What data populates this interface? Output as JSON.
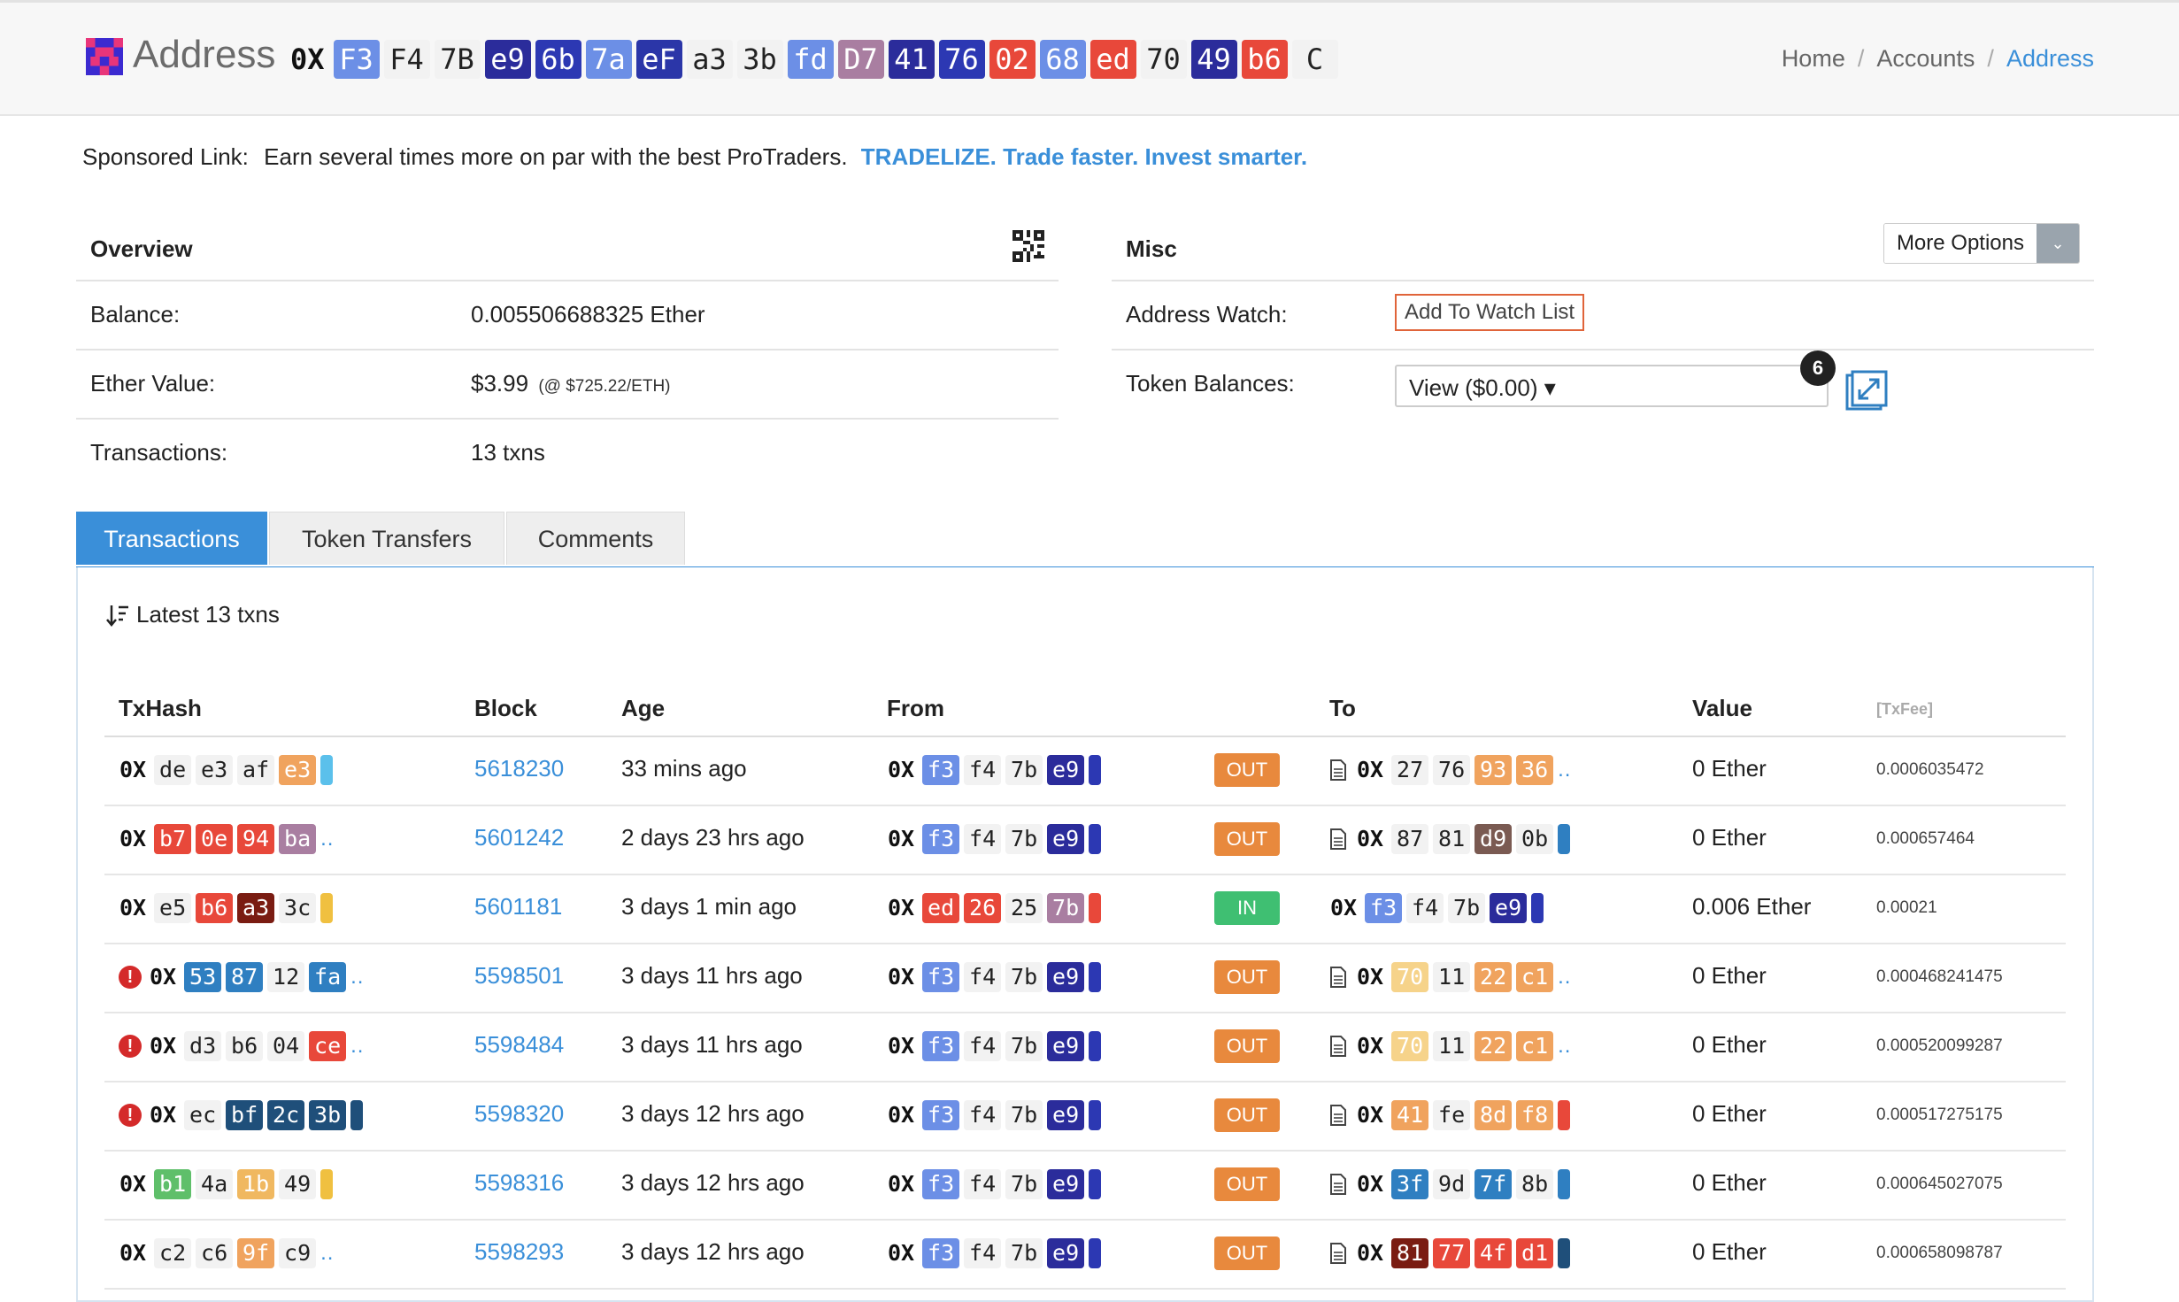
{
  "colors": {
    "accent": "#3a8fd9",
    "out": "#e8893d",
    "in": "#3fbf72",
    "error": "#d42a2a"
  },
  "header": {
    "title": "Address",
    "address": [
      {
        "t": "0X",
        "bg": "",
        "fg": ""
      },
      {
        "t": "F3",
        "bg": "#6c8fe6",
        "fg": "#fff"
      },
      {
        "t": "F4",
        "bg": "#f2f2f2",
        "fg": "#222"
      },
      {
        "t": "7B",
        "bg": "#f2f2f2",
        "fg": "#222"
      },
      {
        "t": "e9",
        "bg": "#2b2c9b",
        "fg": "#fff"
      },
      {
        "t": "6b",
        "bg": "#2c38b3",
        "fg": "#fff"
      },
      {
        "t": "7a",
        "bg": "#6c8fe6",
        "fg": "#fff"
      },
      {
        "t": "eF",
        "bg": "#2b36a8",
        "fg": "#fff"
      },
      {
        "t": "a3",
        "bg": "#f2f2f2",
        "fg": "#222"
      },
      {
        "t": "3b",
        "bg": "#f2f2f2",
        "fg": "#222"
      },
      {
        "t": "fd",
        "bg": "#6c8fe6",
        "fg": "#fff"
      },
      {
        "t": "D7",
        "bg": "#a97ea1",
        "fg": "#fff"
      },
      {
        "t": "41",
        "bg": "#2b2c9b",
        "fg": "#fff"
      },
      {
        "t": "76",
        "bg": "#2c38b3",
        "fg": "#fff"
      },
      {
        "t": "02",
        "bg": "#e8483a",
        "fg": "#fff"
      },
      {
        "t": "68",
        "bg": "#6c8fe6",
        "fg": "#fff"
      },
      {
        "t": "ed",
        "bg": "#e8483a",
        "fg": "#fff"
      },
      {
        "t": "70",
        "bg": "#f2f2f2",
        "fg": "#222"
      },
      {
        "t": "49",
        "bg": "#2b2c9b",
        "fg": "#fff"
      },
      {
        "t": "b6",
        "bg": "#e8483a",
        "fg": "#fff"
      },
      {
        "t": "C",
        "bg": "#f2f2f2",
        "fg": "#222"
      }
    ],
    "breadcrumb": {
      "home": "Home",
      "sep": "/",
      "accounts": "Accounts",
      "current": "Address"
    }
  },
  "sponsored": {
    "label": "Sponsored Link:",
    "text": "Earn several times more on par with the best ProTraders.",
    "link": "TRADELIZE. Trade faster. Invest smarter."
  },
  "overview": {
    "title": "Overview",
    "balance_label": "Balance:",
    "balance_value": "0.005506688325 Ether",
    "ether_value_label": "Ether Value:",
    "ether_value": "$3.99",
    "ether_rate": "(@ $725.22/ETH)",
    "tx_label": "Transactions:",
    "tx_value": "13 txns"
  },
  "misc": {
    "title": "Misc",
    "more_options": "More Options",
    "watch_label": "Address Watch:",
    "watch_button": "Add To Watch List",
    "token_label": "Token Balances:",
    "token_view": "View ($0.00) ▾",
    "token_count": "6"
  },
  "tabs": [
    "Transactions",
    "Token Transfers",
    "Comments"
  ],
  "latest": "Latest 13 txns",
  "table": {
    "headers": {
      "hash": "TxHash",
      "block": "Block",
      "age": "Age",
      "from": "From",
      "to": "To",
      "value": "Value",
      "fee": "[TxFee]"
    },
    "rows": [
      {
        "err": false,
        "hash": [
          {
            "t": "0X"
          },
          {
            "t": "de",
            "bg": "#f2f2f2",
            "fg": "#222"
          },
          {
            "t": "e3",
            "bg": "#f2f2f2",
            "fg": "#222"
          },
          {
            "t": "af",
            "bg": "#f2f2f2",
            "fg": "#222"
          },
          {
            "t": "e3",
            "bg": "#f0a35e",
            "fg": "#fff"
          },
          {
            "tail": "#5bc0eb"
          }
        ],
        "block": "5618230",
        "age": "33 mins ago",
        "from": [
          {
            "t": "0X"
          },
          {
            "t": "f3",
            "bg": "#6c8fe6",
            "fg": "#fff"
          },
          {
            "t": "f4",
            "bg": "#f2f2f2",
            "fg": "#222"
          },
          {
            "t": "7b",
            "bg": "#f2f2f2",
            "fg": "#222"
          },
          {
            "t": "e9",
            "bg": "#2b2c9b",
            "fg": "#fff"
          },
          {
            "tail": "#2c38b3"
          }
        ],
        "dir": "OUT",
        "contract": true,
        "to": [
          {
            "t": "0X"
          },
          {
            "t": "27",
            "bg": "#f2f2f2",
            "fg": "#222"
          },
          {
            "t": "76",
            "bg": "#f2f2f2",
            "fg": "#222"
          },
          {
            "t": "93",
            "bg": "#f0a35e",
            "fg": "#fff"
          },
          {
            "t": "36",
            "bg": "#f0a35e",
            "fg": "#fff"
          },
          {
            "dots": true
          }
        ],
        "value": "0 Ether",
        "fee": "0.0006035472"
      },
      {
        "err": false,
        "hash": [
          {
            "t": "0X"
          },
          {
            "t": "b7",
            "bg": "#e8483a",
            "fg": "#fff"
          },
          {
            "t": "0e",
            "bg": "#e8483a",
            "fg": "#fff"
          },
          {
            "t": "94",
            "bg": "#e8483a",
            "fg": "#fff"
          },
          {
            "t": "ba",
            "bg": "#a97ea1",
            "fg": "#fff"
          },
          {
            "dots": true
          }
        ],
        "block": "5601242",
        "age": "2 days 23 hrs ago",
        "from": [
          {
            "t": "0X"
          },
          {
            "t": "f3",
            "bg": "#6c8fe6",
            "fg": "#fff"
          },
          {
            "t": "f4",
            "bg": "#f2f2f2",
            "fg": "#222"
          },
          {
            "t": "7b",
            "bg": "#f2f2f2",
            "fg": "#222"
          },
          {
            "t": "e9",
            "bg": "#2b2c9b",
            "fg": "#fff"
          },
          {
            "tail": "#2c38b3"
          }
        ],
        "dir": "OUT",
        "contract": true,
        "to": [
          {
            "t": "0X"
          },
          {
            "t": "87",
            "bg": "#f2f2f2",
            "fg": "#222"
          },
          {
            "t": "81",
            "bg": "#f2f2f2",
            "fg": "#222"
          },
          {
            "t": "d9",
            "bg": "#7a5a52",
            "fg": "#fff"
          },
          {
            "t": "0b",
            "bg": "#f2f2f2",
            "fg": "#222"
          },
          {
            "tail": "#2f7fc1"
          }
        ],
        "value": "0 Ether",
        "fee": "0.000657464"
      },
      {
        "err": false,
        "hash": [
          {
            "t": "0X"
          },
          {
            "t": "e5",
            "bg": "#f2f2f2",
            "fg": "#222"
          },
          {
            "t": "b6",
            "bg": "#e8483a",
            "fg": "#fff"
          },
          {
            "t": "a3",
            "bg": "#7a1c12",
            "fg": "#fff"
          },
          {
            "t": "3c",
            "bg": "#f2f2f2",
            "fg": "#222"
          },
          {
            "tail": "#f0c040"
          }
        ],
        "block": "5601181",
        "age": "3 days 1 min ago",
        "from": [
          {
            "t": "0X"
          },
          {
            "t": "ed",
            "bg": "#e8483a",
            "fg": "#fff"
          },
          {
            "t": "26",
            "bg": "#e8483a",
            "fg": "#fff"
          },
          {
            "t": "25",
            "bg": "#f2f2f2",
            "fg": "#222"
          },
          {
            "t": "7b",
            "bg": "#a97ea1",
            "fg": "#fff"
          },
          {
            "tail": "#e8483a"
          }
        ],
        "dir": "IN",
        "contract": false,
        "to": [
          {
            "t": "0X"
          },
          {
            "t": "f3",
            "bg": "#6c8fe6",
            "fg": "#fff"
          },
          {
            "t": "f4",
            "bg": "#f2f2f2",
            "fg": "#222"
          },
          {
            "t": "7b",
            "bg": "#f2f2f2",
            "fg": "#222"
          },
          {
            "t": "e9",
            "bg": "#2b2c9b",
            "fg": "#fff"
          },
          {
            "tail": "#2c38b3"
          }
        ],
        "value": "0.006 Ether",
        "fee": "0.00021"
      },
      {
        "err": true,
        "hash": [
          {
            "t": "0X"
          },
          {
            "t": "53",
            "bg": "#2f7fc1",
            "fg": "#fff"
          },
          {
            "t": "87",
            "bg": "#2f7fc1",
            "fg": "#fff"
          },
          {
            "t": "12",
            "bg": "#f2f2f2",
            "fg": "#222"
          },
          {
            "t": "fa",
            "bg": "#2f7fc1",
            "fg": "#fff"
          },
          {
            "dots": true
          }
        ],
        "block": "5598501",
        "age": "3 days 11 hrs ago",
        "from": [
          {
            "t": "0X"
          },
          {
            "t": "f3",
            "bg": "#6c8fe6",
            "fg": "#fff"
          },
          {
            "t": "f4",
            "bg": "#f2f2f2",
            "fg": "#222"
          },
          {
            "t": "7b",
            "bg": "#f2f2f2",
            "fg": "#222"
          },
          {
            "t": "e9",
            "bg": "#2b2c9b",
            "fg": "#fff"
          },
          {
            "tail": "#2c38b3"
          }
        ],
        "dir": "OUT",
        "contract": true,
        "to": [
          {
            "t": "0X"
          },
          {
            "t": "70",
            "bg": "#f6d38a",
            "fg": "#fff"
          },
          {
            "t": "11",
            "bg": "#f2f2f2",
            "fg": "#222"
          },
          {
            "t": "22",
            "bg": "#f0a35e",
            "fg": "#fff"
          },
          {
            "t": "c1",
            "bg": "#f0a35e",
            "fg": "#fff"
          },
          {
            "dots": true
          }
        ],
        "value": "0 Ether",
        "fee": "0.000468241475"
      },
      {
        "err": true,
        "hash": [
          {
            "t": "0X"
          },
          {
            "t": "d3",
            "bg": "#f2f2f2",
            "fg": "#222"
          },
          {
            "t": "b6",
            "bg": "#f2f2f2",
            "fg": "#222"
          },
          {
            "t": "04",
            "bg": "#f2f2f2",
            "fg": "#222"
          },
          {
            "t": "ce",
            "bg": "#e8483a",
            "fg": "#fff"
          },
          {
            "dots": true
          }
        ],
        "block": "5598484",
        "age": "3 days 11 hrs ago",
        "from": [
          {
            "t": "0X"
          },
          {
            "t": "f3",
            "bg": "#6c8fe6",
            "fg": "#fff"
          },
          {
            "t": "f4",
            "bg": "#f2f2f2",
            "fg": "#222"
          },
          {
            "t": "7b",
            "bg": "#f2f2f2",
            "fg": "#222"
          },
          {
            "t": "e9",
            "bg": "#2b2c9b",
            "fg": "#fff"
          },
          {
            "tail": "#2c38b3"
          }
        ],
        "dir": "OUT",
        "contract": true,
        "to": [
          {
            "t": "0X"
          },
          {
            "t": "70",
            "bg": "#f6d38a",
            "fg": "#fff"
          },
          {
            "t": "11",
            "bg": "#f2f2f2",
            "fg": "#222"
          },
          {
            "t": "22",
            "bg": "#f0a35e",
            "fg": "#fff"
          },
          {
            "t": "c1",
            "bg": "#f0a35e",
            "fg": "#fff"
          },
          {
            "dots": true
          }
        ],
        "value": "0 Ether",
        "fee": "0.000520099287"
      },
      {
        "err": true,
        "hash": [
          {
            "t": "0X"
          },
          {
            "t": "ec",
            "bg": "#f2f2f2",
            "fg": "#222"
          },
          {
            "t": "bf",
            "bg": "#1f4f7a",
            "fg": "#fff"
          },
          {
            "t": "2c",
            "bg": "#1f4f7a",
            "fg": "#fff"
          },
          {
            "t": "3b",
            "bg": "#1f4f7a",
            "fg": "#fff"
          },
          {
            "tail": "#1f4f7a"
          }
        ],
        "block": "5598320",
        "age": "3 days 12 hrs ago",
        "from": [
          {
            "t": "0X"
          },
          {
            "t": "f3",
            "bg": "#6c8fe6",
            "fg": "#fff"
          },
          {
            "t": "f4",
            "bg": "#f2f2f2",
            "fg": "#222"
          },
          {
            "t": "7b",
            "bg": "#f2f2f2",
            "fg": "#222"
          },
          {
            "t": "e9",
            "bg": "#2b2c9b",
            "fg": "#fff"
          },
          {
            "tail": "#2c38b3"
          }
        ],
        "dir": "OUT",
        "contract": true,
        "to": [
          {
            "t": "0X"
          },
          {
            "t": "41",
            "bg": "#f0a35e",
            "fg": "#fff"
          },
          {
            "t": "fe",
            "bg": "#f2f2f2",
            "fg": "#222"
          },
          {
            "t": "8d",
            "bg": "#f0a35e",
            "fg": "#fff"
          },
          {
            "t": "f8",
            "bg": "#f0a35e",
            "fg": "#fff"
          },
          {
            "tail": "#e8483a"
          }
        ],
        "value": "0 Ether",
        "fee": "0.000517275175"
      },
      {
        "err": false,
        "hash": [
          {
            "t": "0X"
          },
          {
            "t": "b1",
            "bg": "#5fbf6a",
            "fg": "#fff"
          },
          {
            "t": "4a",
            "bg": "#f2f2f2",
            "fg": "#222"
          },
          {
            "t": "1b",
            "bg": "#f0b860",
            "fg": "#fff"
          },
          {
            "t": "49",
            "bg": "#f2f2f2",
            "fg": "#222"
          },
          {
            "tail": "#f0c040"
          }
        ],
        "block": "5598316",
        "age": "3 days 12 hrs ago",
        "from": [
          {
            "t": "0X"
          },
          {
            "t": "f3",
            "bg": "#6c8fe6",
            "fg": "#fff"
          },
          {
            "t": "f4",
            "bg": "#f2f2f2",
            "fg": "#222"
          },
          {
            "t": "7b",
            "bg": "#f2f2f2",
            "fg": "#222"
          },
          {
            "t": "e9",
            "bg": "#2b2c9b",
            "fg": "#fff"
          },
          {
            "tail": "#2c38b3"
          }
        ],
        "dir": "OUT",
        "contract": true,
        "to": [
          {
            "t": "0X"
          },
          {
            "t": "3f",
            "bg": "#2f7fc1",
            "fg": "#fff"
          },
          {
            "t": "9d",
            "bg": "#f2f2f2",
            "fg": "#222"
          },
          {
            "t": "7f",
            "bg": "#2f7fc1",
            "fg": "#fff"
          },
          {
            "t": "8b",
            "bg": "#f2f2f2",
            "fg": "#222"
          },
          {
            "tail": "#2f7fc1"
          }
        ],
        "value": "0 Ether",
        "fee": "0.000645027075"
      },
      {
        "err": false,
        "hash": [
          {
            "t": "0X"
          },
          {
            "t": "c2",
            "bg": "#f2f2f2",
            "fg": "#222"
          },
          {
            "t": "c6",
            "bg": "#f2f2f2",
            "fg": "#222"
          },
          {
            "t": "9f",
            "bg": "#f0a35e",
            "fg": "#fff"
          },
          {
            "t": "c9",
            "bg": "#f2f2f2",
            "fg": "#222"
          },
          {
            "dots": true
          }
        ],
        "block": "5598293",
        "age": "3 days 12 hrs ago",
        "from": [
          {
            "t": "0X"
          },
          {
            "t": "f3",
            "bg": "#6c8fe6",
            "fg": "#fff"
          },
          {
            "t": "f4",
            "bg": "#f2f2f2",
            "fg": "#222"
          },
          {
            "t": "7b",
            "bg": "#f2f2f2",
            "fg": "#222"
          },
          {
            "t": "e9",
            "bg": "#2b2c9b",
            "fg": "#fff"
          },
          {
            "tail": "#2c38b3"
          }
        ],
        "dir": "OUT",
        "contract": true,
        "to": [
          {
            "t": "0X"
          },
          {
            "t": "81",
            "bg": "#7a1c12",
            "fg": "#fff"
          },
          {
            "t": "77",
            "bg": "#e8483a",
            "fg": "#fff"
          },
          {
            "t": "4f",
            "bg": "#e8483a",
            "fg": "#fff"
          },
          {
            "t": "d1",
            "bg": "#e8483a",
            "fg": "#fff"
          },
          {
            "tail": "#1f4f7a"
          }
        ],
        "value": "0 Ether",
        "fee": "0.000658098787"
      }
    ]
  }
}
